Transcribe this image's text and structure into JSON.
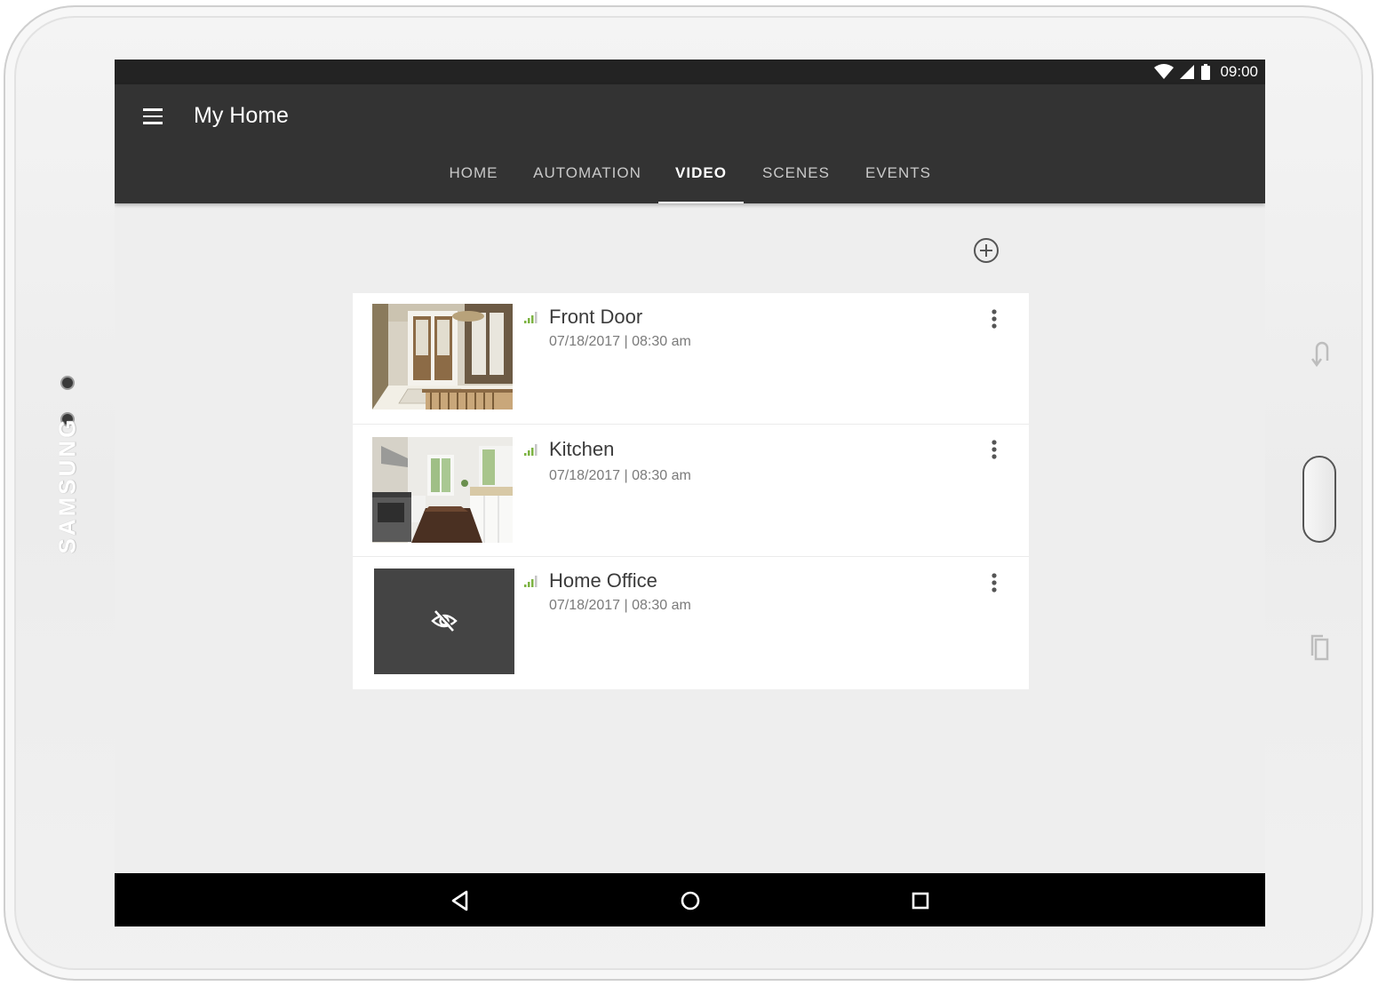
{
  "device": {
    "brand": "SAMSUNG"
  },
  "status_bar": {
    "time": "09:00",
    "icons": [
      "wifi-icon",
      "cell-signal-icon",
      "battery-icon"
    ]
  },
  "app_bar": {
    "menu_icon": "hamburger-menu-icon",
    "title": "My Home"
  },
  "tabs": [
    {
      "label": "HOME",
      "active": false
    },
    {
      "label": "AUTOMATION",
      "active": false
    },
    {
      "label": "VIDEO",
      "active": true
    },
    {
      "label": "SCENES",
      "active": false
    },
    {
      "label": "EVENTS",
      "active": false
    }
  ],
  "actions": {
    "add_icon": "add-circle-icon"
  },
  "cameras": [
    {
      "name": "Front Door",
      "timestamp": "07/18/2017 | 08:30 am",
      "thumbnail": "entryway-photo",
      "signal_icon": "signal-strength-icon",
      "menu_icon": "more-vert-icon"
    },
    {
      "name": "Kitchen",
      "timestamp": "07/18/2017 | 08:30 am",
      "thumbnail": "kitchen-photo",
      "signal_icon": "signal-strength-icon",
      "menu_icon": "more-vert-icon"
    },
    {
      "name": "Home Office",
      "timestamp": "07/18/2017 | 08:30 am",
      "thumbnail": "hidden",
      "thumbnail_icon": "visibility-off-icon",
      "signal_icon": "signal-strength-icon",
      "menu_icon": "more-vert-icon"
    }
  ],
  "nav_bar": {
    "icons": [
      "back-icon",
      "home-icon",
      "recents-icon"
    ]
  },
  "colors": {
    "app_bar": "#333333",
    "status_bar": "#232323",
    "background": "#eeeeee",
    "card": "#ffffff",
    "signal_accent": "#7cb342",
    "hidden_thumbnail": "#444444"
  }
}
